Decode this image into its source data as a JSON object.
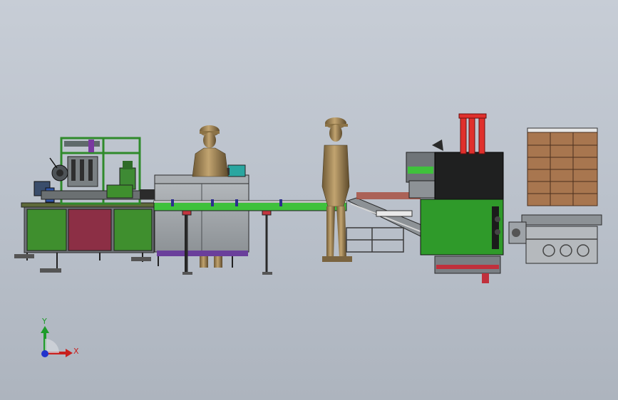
{
  "axis_triad": {
    "y_label": "Y",
    "x_label": "X"
  },
  "colors": {
    "frame_green": "#2f8a2b",
    "panel_green": "#3f8f2e",
    "panel_red": "#8c2f45",
    "steel_gray": "#9ea3a8",
    "conveyor_green": "#3fc13c",
    "carton_brown": "#a8764f",
    "lift_red": "#e0302c",
    "hood_black": "#1f2020",
    "worker_bronze": "#a8895a"
  },
  "components": [
    "filling-capping-station",
    "inspection-table",
    "main-conveyor",
    "incline-conveyor",
    "case-packer",
    "palletizer",
    "pallet-stack"
  ]
}
